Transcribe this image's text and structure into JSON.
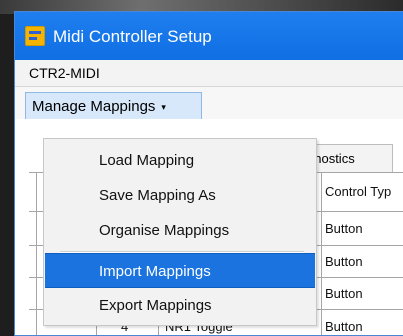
{
  "window": {
    "title": "Midi Controller Setup",
    "title_icon": "midi-app-icon",
    "accent_color": "#1f7ff0"
  },
  "menubar": {
    "items": [
      "CTR2-MIDI"
    ]
  },
  "toolbar": {
    "manage_label": "Manage Mappings",
    "manage_caret": "▾"
  },
  "tabs": {
    "partial_label": "gnostics"
  },
  "table": {
    "header_partial": "Control Typ",
    "rows": [
      {
        "c3": "Button"
      },
      {
        "c3": "Button"
      },
      {
        "c3": "Button"
      },
      {
        "c1": "4",
        "c2": "NR1 Toggle",
        "c3": "Button"
      }
    ]
  },
  "dropdown": {
    "items": [
      {
        "label": "Load Mapping",
        "selected": false
      },
      {
        "label": "Save Mapping As",
        "selected": false
      },
      {
        "label": "Organise Mappings",
        "selected": false
      },
      {
        "label": "Import Mappings",
        "selected": true
      },
      {
        "label": "Export Mappings",
        "selected": false
      }
    ]
  }
}
